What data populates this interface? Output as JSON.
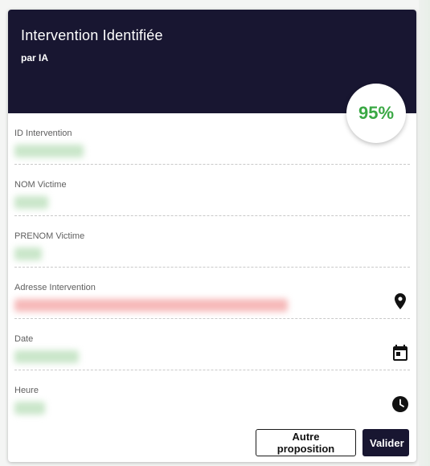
{
  "card": {
    "title": "Intervention Identifiée",
    "subtitle": "par IA",
    "confidence": "95%",
    "confidence_color": "#3aa844",
    "header_color": "#181631"
  },
  "fields": [
    {
      "label": "ID Intervention",
      "value_state": "blurred",
      "value_tint": "#c9e6c9"
    },
    {
      "label": "NOM Victime",
      "value_state": "blurred",
      "value_tint": "#c9e6c9"
    },
    {
      "label": "PRENOM Victime",
      "value_state": "blurred",
      "value_tint": "#c9e6c9"
    },
    {
      "label": "Adresse Intervention",
      "value_state": "blurred",
      "value_tint": "#f6b9b9",
      "icon": "location-pin-icon"
    },
    {
      "label": "Date",
      "value_state": "blurred",
      "value_tint": "#c9e6c9",
      "icon": "calendar-icon"
    },
    {
      "label": "Heure",
      "value_state": "blurred",
      "value_tint": "#c9e6c9",
      "icon": "clock-icon"
    }
  ],
  "actions": {
    "secondary_label": "Autre proposition",
    "primary_label": "Valider"
  }
}
